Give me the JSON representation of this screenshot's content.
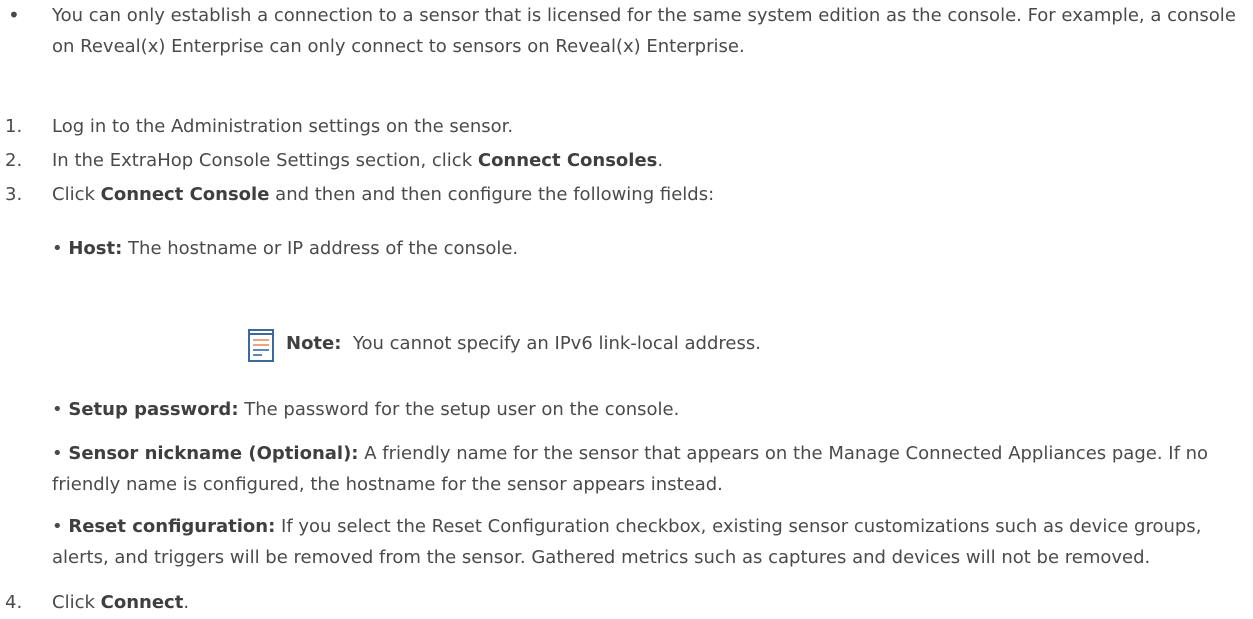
{
  "intro_bullet": {
    "marker": "•",
    "text": "You can only establish a connection to a sensor that is licensed for the same system edition as the console. For example, a console on Reveal(x) Enterprise can only connect to sensors on Reveal(x) Enterprise."
  },
  "steps": [
    {
      "number": "1.",
      "text": "Log in to the Administration settings on the sensor."
    },
    {
      "number": "2.",
      "before": "In the ExtraHop Console Settings section, click ",
      "bold": "Connect Consoles",
      "after": "."
    },
    {
      "number": "3.",
      "before": "Click ",
      "bold": "Connect Console",
      "after": " and then and then configure the following fields:"
    },
    {
      "number": "4.",
      "before": "Click ",
      "bold": "Connect",
      "after": "."
    }
  ],
  "fields": [
    {
      "bullet": "•",
      "label": "Host:",
      "text": " The hostname or IP address of the console."
    },
    {
      "bullet": "•",
      "label": "Setup password:",
      "text": " The password for the setup user on the console."
    },
    {
      "bullet": "•",
      "label": "Sensor nickname (Optional):",
      "text": " A friendly name for the sensor that appears on the Manage Connected Appliances page. If no friendly name is configured, the hostname for the sensor appears instead."
    },
    {
      "bullet": "•",
      "label": "Reset configuration:",
      "text": " If you select the Reset Configuration checkbox, existing sensor customizations such as device groups, alerts, and triggers will be removed from the sensor. Gathered metrics such as captures and devices will not be removed."
    }
  ],
  "note": {
    "icon": "note-icon",
    "label": "Note:",
    "text": "  You cannot specify an IPv6 link-local address."
  },
  "colors": {
    "text": "#4a4a4a",
    "note_icon_border": "#3a6b9c",
    "note_icon_lines": [
      "#f0a27d",
      "#f0a27d",
      "#5b88b8",
      "#5b88b8"
    ]
  }
}
